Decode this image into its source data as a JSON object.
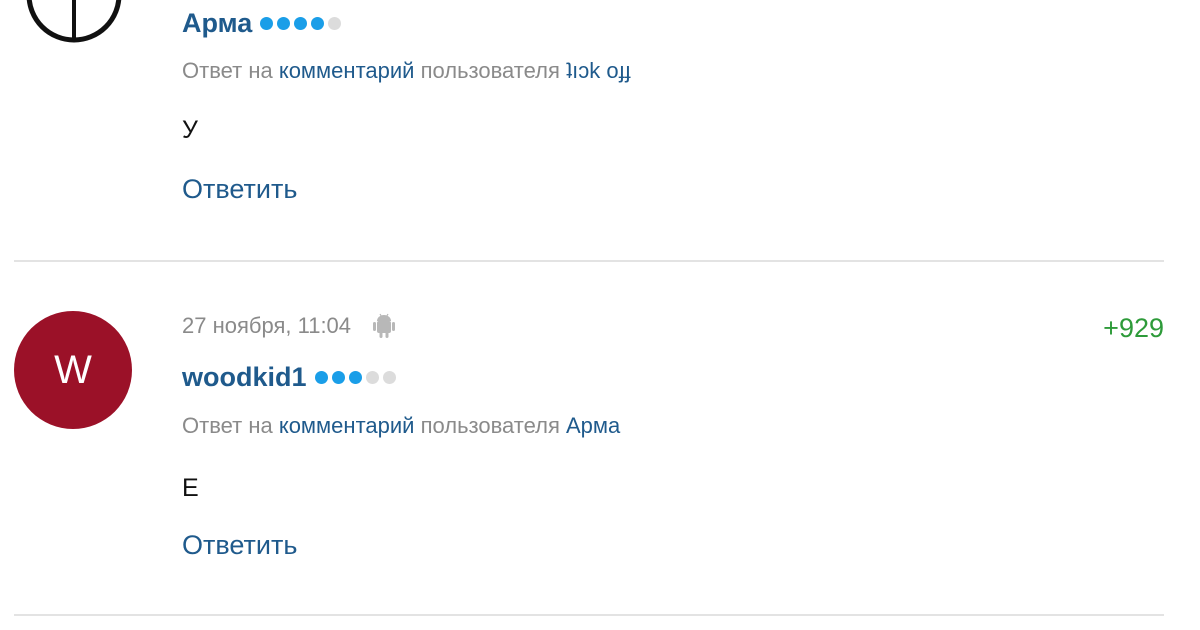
{
  "colors": {
    "link": "#1f5a8c",
    "muted": "#8a8a8a",
    "rating_positive": "#2e9b3a",
    "dot_active": "#1a9ee8",
    "dot_inactive": "#dcdcdc",
    "avatar_bg": "#9b1128",
    "divider": "#e3e3e3"
  },
  "comments": [
    {
      "avatar_icon": "crosshair-icon",
      "username": "Арма",
      "rank_dots": {
        "active": 4,
        "total": 5
      },
      "reply_prefix": "Ответ на ",
      "reply_link": "комментарий",
      "reply_middle": " пользователя ",
      "reply_user": "ʇıɔk оɟɟ",
      "text": "У",
      "reply_button": "Ответить"
    },
    {
      "avatar_letter": "W",
      "date": "27 ноября, 11:04",
      "device_icon": "android-icon",
      "rating": "+929",
      "username": "woodkid1",
      "rank_dots": {
        "active": 3,
        "total": 5
      },
      "reply_prefix": "Ответ на ",
      "reply_link": "комментарий",
      "reply_middle": " пользователя ",
      "reply_user": "Арма",
      "text": "Е",
      "reply_button": "Ответить"
    }
  ]
}
